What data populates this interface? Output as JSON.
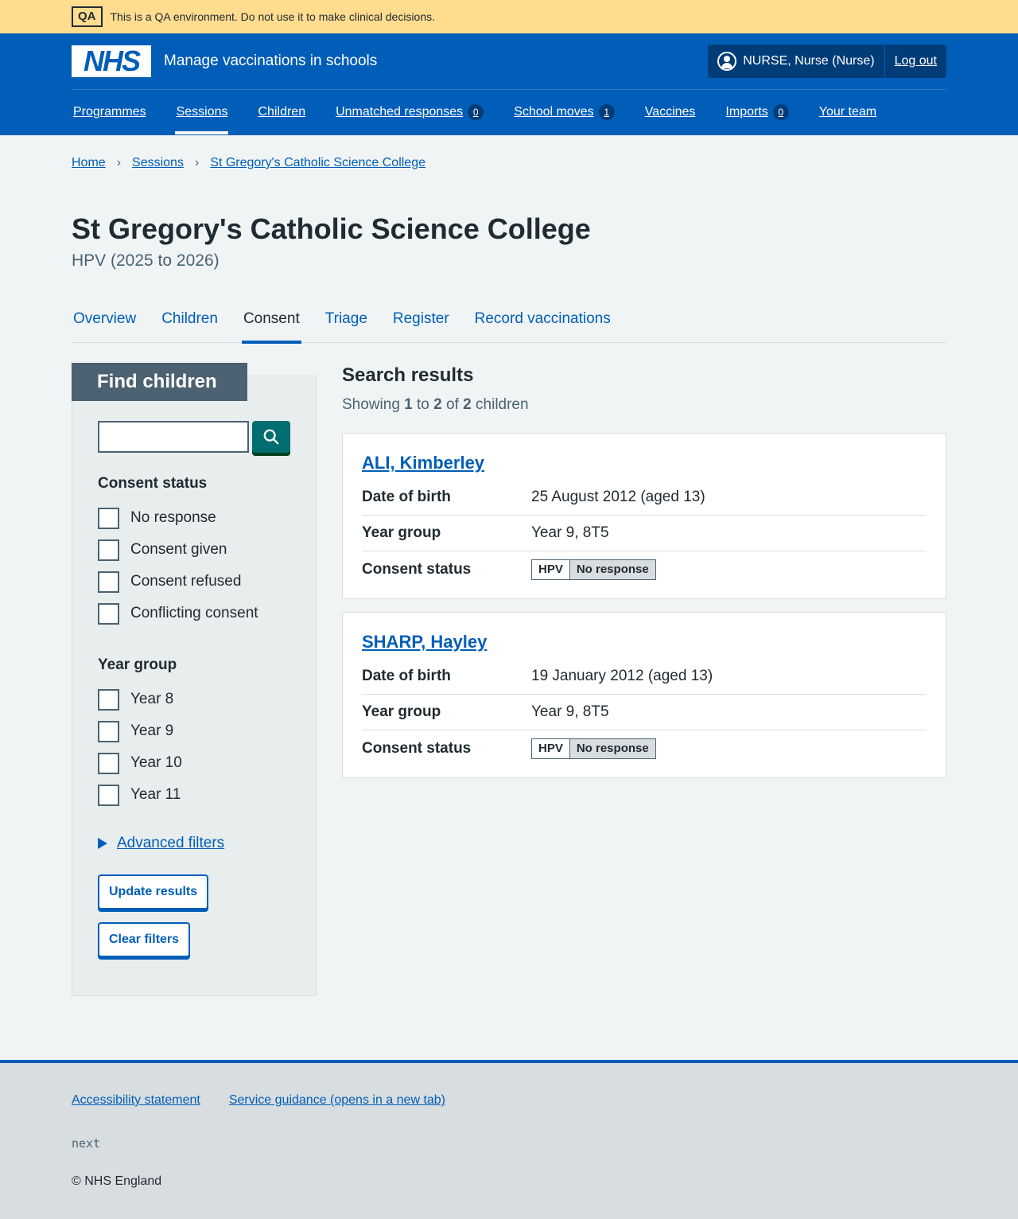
{
  "qa_banner": {
    "tag": "QA",
    "text": "This is a QA environment. Do not use it to make clinical decisions."
  },
  "header": {
    "logo": "NHS",
    "service_name": "Manage vaccinations in schools",
    "user": "NURSE, Nurse (Nurse)",
    "logout": "Log out",
    "nav": [
      {
        "label": "Programmes"
      },
      {
        "label": "Sessions",
        "active": true
      },
      {
        "label": "Children"
      },
      {
        "label": "Unmatched responses",
        "count": "0"
      },
      {
        "label": "School moves",
        "count": "1"
      },
      {
        "label": "Vaccines"
      },
      {
        "label": "Imports",
        "count": "0"
      },
      {
        "label": "Your team"
      }
    ]
  },
  "breadcrumb": [
    "Home",
    "Sessions",
    "St Gregory's Catholic Science College"
  ],
  "page": {
    "title": "St Gregory's Catholic Science College",
    "subtitle": "HPV (2025 to 2026)",
    "tabs": [
      "Overview",
      "Children",
      "Consent",
      "Triage",
      "Register",
      "Record vaccinations"
    ],
    "active_tab": "Consent"
  },
  "filters": {
    "heading": "Find children",
    "search_value": "",
    "consent_legend": "Consent status",
    "consent_options": [
      "No response",
      "Consent given",
      "Consent refused",
      "Conflicting consent"
    ],
    "year_legend": "Year group",
    "year_options": [
      "Year 8",
      "Year 9",
      "Year 10",
      "Year 11"
    ],
    "advanced": "Advanced filters",
    "update": "Update results",
    "clear": "Clear filters"
  },
  "results": {
    "heading": "Search results",
    "showing_prefix": "Showing",
    "from": "1",
    "to_word": "to",
    "to": "2",
    "of_word": "of",
    "total": "2",
    "suffix": "children",
    "labels": {
      "dob": "Date of birth",
      "year": "Year group",
      "consent": "Consent status"
    },
    "children": [
      {
        "name": "ALI, Kimberley",
        "dob": "25 August 2012 (aged 13)",
        "year": "Year 9, 8T5",
        "programme": "HPV",
        "status": "No response"
      },
      {
        "name": "SHARP, Hayley",
        "dob": "19 January 2012 (aged 13)",
        "year": "Year 9, 8T5",
        "programme": "HPV",
        "status": "No response"
      }
    ]
  },
  "footer": {
    "links": [
      "Accessibility statement",
      "Service guidance (opens in a new tab)"
    ],
    "version": "next",
    "copyright": "© NHS England"
  }
}
